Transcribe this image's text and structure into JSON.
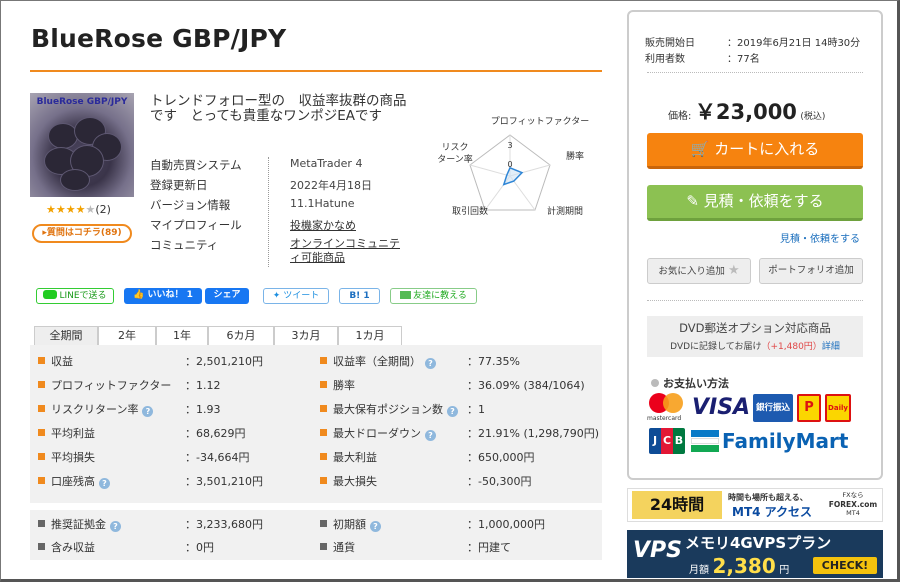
{
  "product": {
    "title": "BlueRose GBP/JPY",
    "image_label": "BlueRose GBP/JPY",
    "rating_stars": "★★★★",
    "rating_empty": "★",
    "rating_count": "(2)",
    "question_button": "▸質問はコチラ(89)",
    "description": "トレンドフォロー型の　収益率抜群の商品です　とっても貴重なワンポジEAです",
    "info": [
      {
        "key": "自動売買システム",
        "value": "MetaTrader 4"
      },
      {
        "key": "登録更新日",
        "value": "2022年4月18日"
      },
      {
        "key": "バージョン情報",
        "value": "11.1Hatune"
      },
      {
        "key": "マイプロフィール",
        "value": "投機家かなめ"
      },
      {
        "key": "コミュニティ",
        "value": "オンラインコミュニティ可能商品"
      }
    ]
  },
  "radar": {
    "labels": [
      "プロフィットファクター",
      "勝率",
      "計測期間",
      "取引回数",
      "リスクリターン率"
    ],
    "label_riskreturn_1": "リスク",
    "label_riskreturn_2": "ターン率",
    "scale_label": "3",
    "center_label": "0",
    "values": [
      0.2,
      0.3,
      0.15,
      0.25,
      0.05
    ],
    "max": 3
  },
  "social": {
    "line": "LINEで送る",
    "like": "いいね！ 1",
    "share": "シェア",
    "tweet": "ツイート",
    "hatena": "B! 1",
    "mail": "友達に教える"
  },
  "tabs": [
    "全期間",
    "2年",
    "1年",
    "6カ月",
    "3カ月",
    "1カ月"
  ],
  "stats_left": [
    {
      "label": "収益",
      "value": "：2,501,210円",
      "help": false
    },
    {
      "label": "プロフィットファクター",
      "value": "：1.12",
      "help": false
    },
    {
      "label": "リスクリターン率",
      "value": "：1.93",
      "help": true
    },
    {
      "label": "平均利益",
      "value": "：68,629円",
      "help": false
    },
    {
      "label": "平均損失",
      "value": "：-34,664円",
      "help": false
    },
    {
      "label": "口座残高",
      "value": "：3,501,210円",
      "help": true
    }
  ],
  "stats_right": [
    {
      "label": "収益率（全期間）",
      "value": "：77.35%",
      "help": true
    },
    {
      "label": "勝率",
      "value": "：36.09% (384/1064)",
      "help": false
    },
    {
      "label": "最大保有ポジション数",
      "value": "：1",
      "help": true
    },
    {
      "label": "最大ドローダウン",
      "value": "：21.91% (1,298,790円)",
      "help": true
    },
    {
      "label": "最大利益",
      "value": "：650,000円",
      "help": false
    },
    {
      "label": "最大損失",
      "value": "：-50,300円",
      "help": false
    }
  ],
  "stats2_left": [
    {
      "label": "推奨証拠金",
      "value": "：3,233,680円",
      "help": true
    },
    {
      "label": "含み収益",
      "value": "：0円",
      "help": false
    }
  ],
  "stats2_right": [
    {
      "label": "初期額",
      "value": "：1,000,000円",
      "help": true
    },
    {
      "label": "通貨",
      "value": "：円建て",
      "help": false
    }
  ],
  "sidebar": {
    "sale_start_label": "販売開始日",
    "sale_start_value": "：2019年6月21日 14時30分",
    "users_label": "利用者数",
    "users_value": "：77名",
    "price_label": "価格:",
    "price_value": "￥23,000",
    "price_tax": "(税込)",
    "cart_button": "カートに入れる",
    "quote_button": "見積・依頼をする",
    "quote_link": "見積・依頼をする",
    "favorite_button": "お気に入り追加",
    "portfolio_button": "ポートフォリオ追加",
    "dvd_title": "DVD郵送オプション対応商品",
    "dvd_note": "DVDに記録してお届け",
    "dvd_price": "（+1,480円）",
    "dvd_detail": "詳細",
    "payment_title": "お支払い方法",
    "pay_mastercard": "mastercard",
    "pay_visa": "VISA",
    "pay_bank": "銀行振込",
    "pay_jcb": "JCB",
    "pay_familymart": "FamilyMart"
  },
  "banners": {
    "b1_main": "24時間",
    "b1_sub1": "時間も場所も超える、",
    "b1_sub2": "MT4 アクセス",
    "b1_logo1": "FXなら",
    "b1_logo2": "FOREX.com",
    "b1_logo3": "MT4",
    "b2_main": "VPS",
    "b2_title": "メモリ4GVPSプラン",
    "b2_price_prefix": "月額",
    "b2_price": "2,380",
    "b2_unit": "円",
    "b2_check": "CHECK!"
  },
  "colors": {
    "accent": "#f08a1e",
    "cart": "#f6830f",
    "quote": "#8cc152",
    "link": "#1a6ebd"
  }
}
